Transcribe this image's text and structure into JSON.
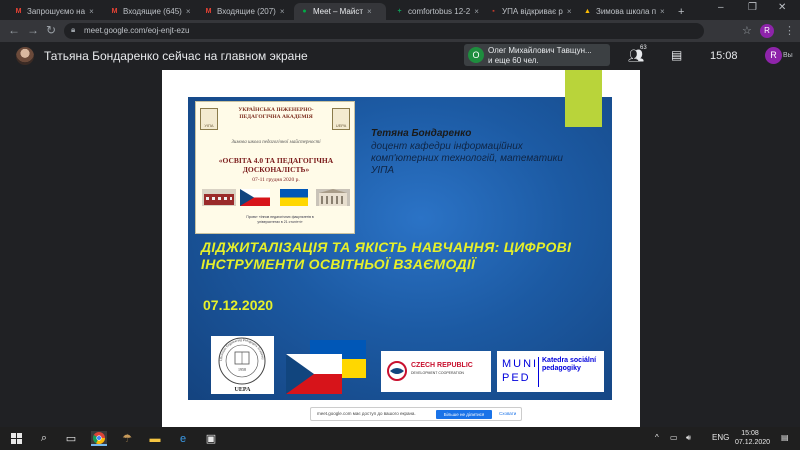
{
  "browser": {
    "tabs": [
      {
        "label": "Запрошуємо на",
        "fav": "M",
        "favColor": "#ea4335"
      },
      {
        "label": "Входящие (645)",
        "fav": "M",
        "favColor": "#ea4335"
      },
      {
        "label": "Входящие (207)",
        "fav": "M",
        "favColor": "#ea4335"
      },
      {
        "label": "Meet – Майст",
        "fav": "●",
        "favColor": "#00ac47"
      },
      {
        "label": "comfortobus 12-2",
        "fav": "+",
        "favColor": "#0f9d58"
      },
      {
        "label": "УПА відкриває р",
        "fav": "▪",
        "favColor": "#c0392b"
      },
      {
        "label": "Зимова школа п",
        "fav": "▲",
        "favColor": "#fbbc04"
      }
    ],
    "url": "meet.google.com/eoj-enjt-ezu"
  },
  "meet": {
    "presenter_banner": "Татьяна Бондаренко сейчас на главном экране",
    "toast_avatar": "O",
    "toast_line1": "Олег Михайлович Тавщун...",
    "toast_line2": "и еще 60 чел.",
    "people_count": "63",
    "clock": "15:08",
    "avatar_letter": "R",
    "you_label": "Вы"
  },
  "slide": {
    "poster": {
      "header": "УКРАЇНСЬКА ІНЖЕНЕРНО-ПЕДАГОГІЧНА АКАДЕМІЯ",
      "logo_left": "УІПА",
      "logo_right": "UEPA",
      "subtitle": "Зимова школа педагогічної майстерності",
      "title": "«ОСВІТА 4.0 ТА ПЕДАГОГІЧНА ДОСКОНАЛІСТЬ»",
      "date": "07-11 грудня 2020 р.",
      "footer": "Проект «Іннов педагогічних факультетів в університетах в 21 столітті»"
    },
    "author_name": "Тетяна Бондаренко",
    "author_role": "доцент кафедри інформаційних комп'ютерних технологій, математики УІПА",
    "talk_title": "ДІДЖИТАЛІЗАЦІЯ ТА ЯКІСТЬ НАВЧАННЯ: ЦИФРОВІ ІНСТРУМЕНТИ ОСВІТНЬОЇ ВЗАЄМОДІЇ",
    "talk_date": "07.12.2020",
    "uepa_label": "UEPA",
    "uepa_ring": "Ukrainian Engineering Pedagogics Academy",
    "uepa_year": "1958",
    "czech_title": "CZECH REPUBLIC",
    "czech_sub": "DEVELOPMENT COOPERATION",
    "muni_top": "MUNI",
    "muni_bottom": "PED",
    "katedra": "Katedra sociální pedagogiky"
  },
  "share_banner": {
    "message": "meet.google.com має доступ до вашого екрана.",
    "stop_label": "Більше не ділитися",
    "hide_label": "Сховати"
  },
  "taskbar": {
    "lang": "ENG",
    "time": "15:08",
    "date": "07.12.2020"
  }
}
